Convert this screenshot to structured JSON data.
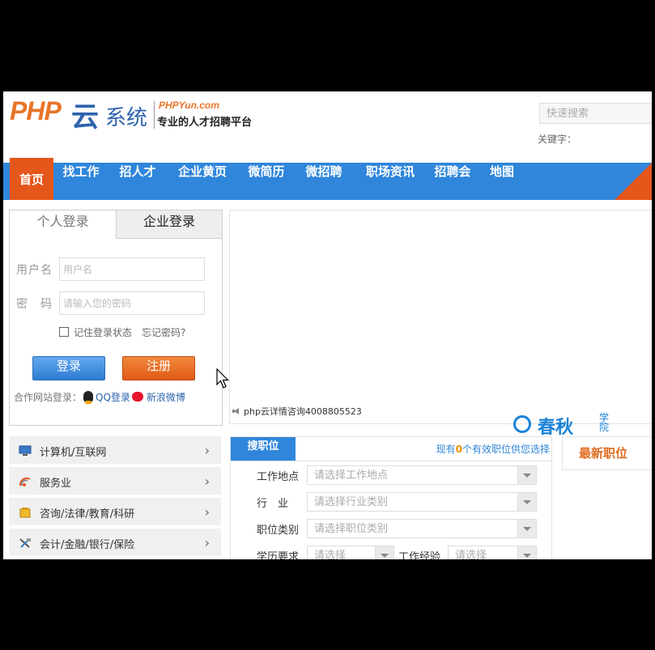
{
  "header": {
    "logo_php": "PHP",
    "logo_yun": "云",
    "logo_xitong": "系统",
    "logo_domain": "PHPYun.com",
    "logo_slogan": "专业的人才招聘平台",
    "search_placeholder": "快速搜索",
    "keyword_label": "关键字："
  },
  "nav": {
    "items": [
      "首页",
      "找工作",
      "招人才",
      "企业黄页",
      "微简历",
      "微招聘",
      "职场资讯",
      "招聘会",
      "地图"
    ]
  },
  "login": {
    "tab_personal": "个人登录",
    "tab_company": "企业登录",
    "username_label": "用户名",
    "username_placeholder": "用户名",
    "password_label": "密　码",
    "password_placeholder": "请输入您的密码",
    "remember_label": "记住登录状态",
    "forgot_label": "忘记密码?",
    "login_button": "登录",
    "register_button": "注册",
    "partner_label": "合作网站登录：",
    "qq_label": "QQ登录",
    "weibo_label": "新浪微博"
  },
  "banner": {
    "notice": "php云详情咨询4008805523"
  },
  "categories": [
    {
      "label": "计算机/互联网",
      "icon": "computer-icon"
    },
    {
      "label": "服务业",
      "icon": "service-icon"
    },
    {
      "label": "咨询/法律/教育/科研",
      "icon": "education-icon"
    },
    {
      "label": "会计/金融/银行/保险",
      "icon": "finance-icon"
    }
  ],
  "job_search": {
    "tab_label": "搜职位",
    "count_prefix": "现有",
    "count_value": "0",
    "count_suffix": "个有效职位供您选择",
    "location_label": "工作地点",
    "location_placeholder": "请选择工作地点",
    "industry_label": "行　业",
    "industry_placeholder": "请选择行业类别",
    "category_label": "职位类别",
    "category_placeholder": "请选择职位类别",
    "education_label": "学历要求",
    "education_placeholder": "请选择",
    "experience_label": "工作经验",
    "experience_placeholder": "请选择"
  },
  "latest": {
    "title": "最新职位"
  },
  "watermark": {
    "text": "春秋",
    "sub": "学院"
  },
  "colors": {
    "nav_blue": "#2f86db",
    "accent_orange": "#e5561b",
    "logo_blue": "#2e63ad",
    "logo_orange": "#e8742a"
  }
}
